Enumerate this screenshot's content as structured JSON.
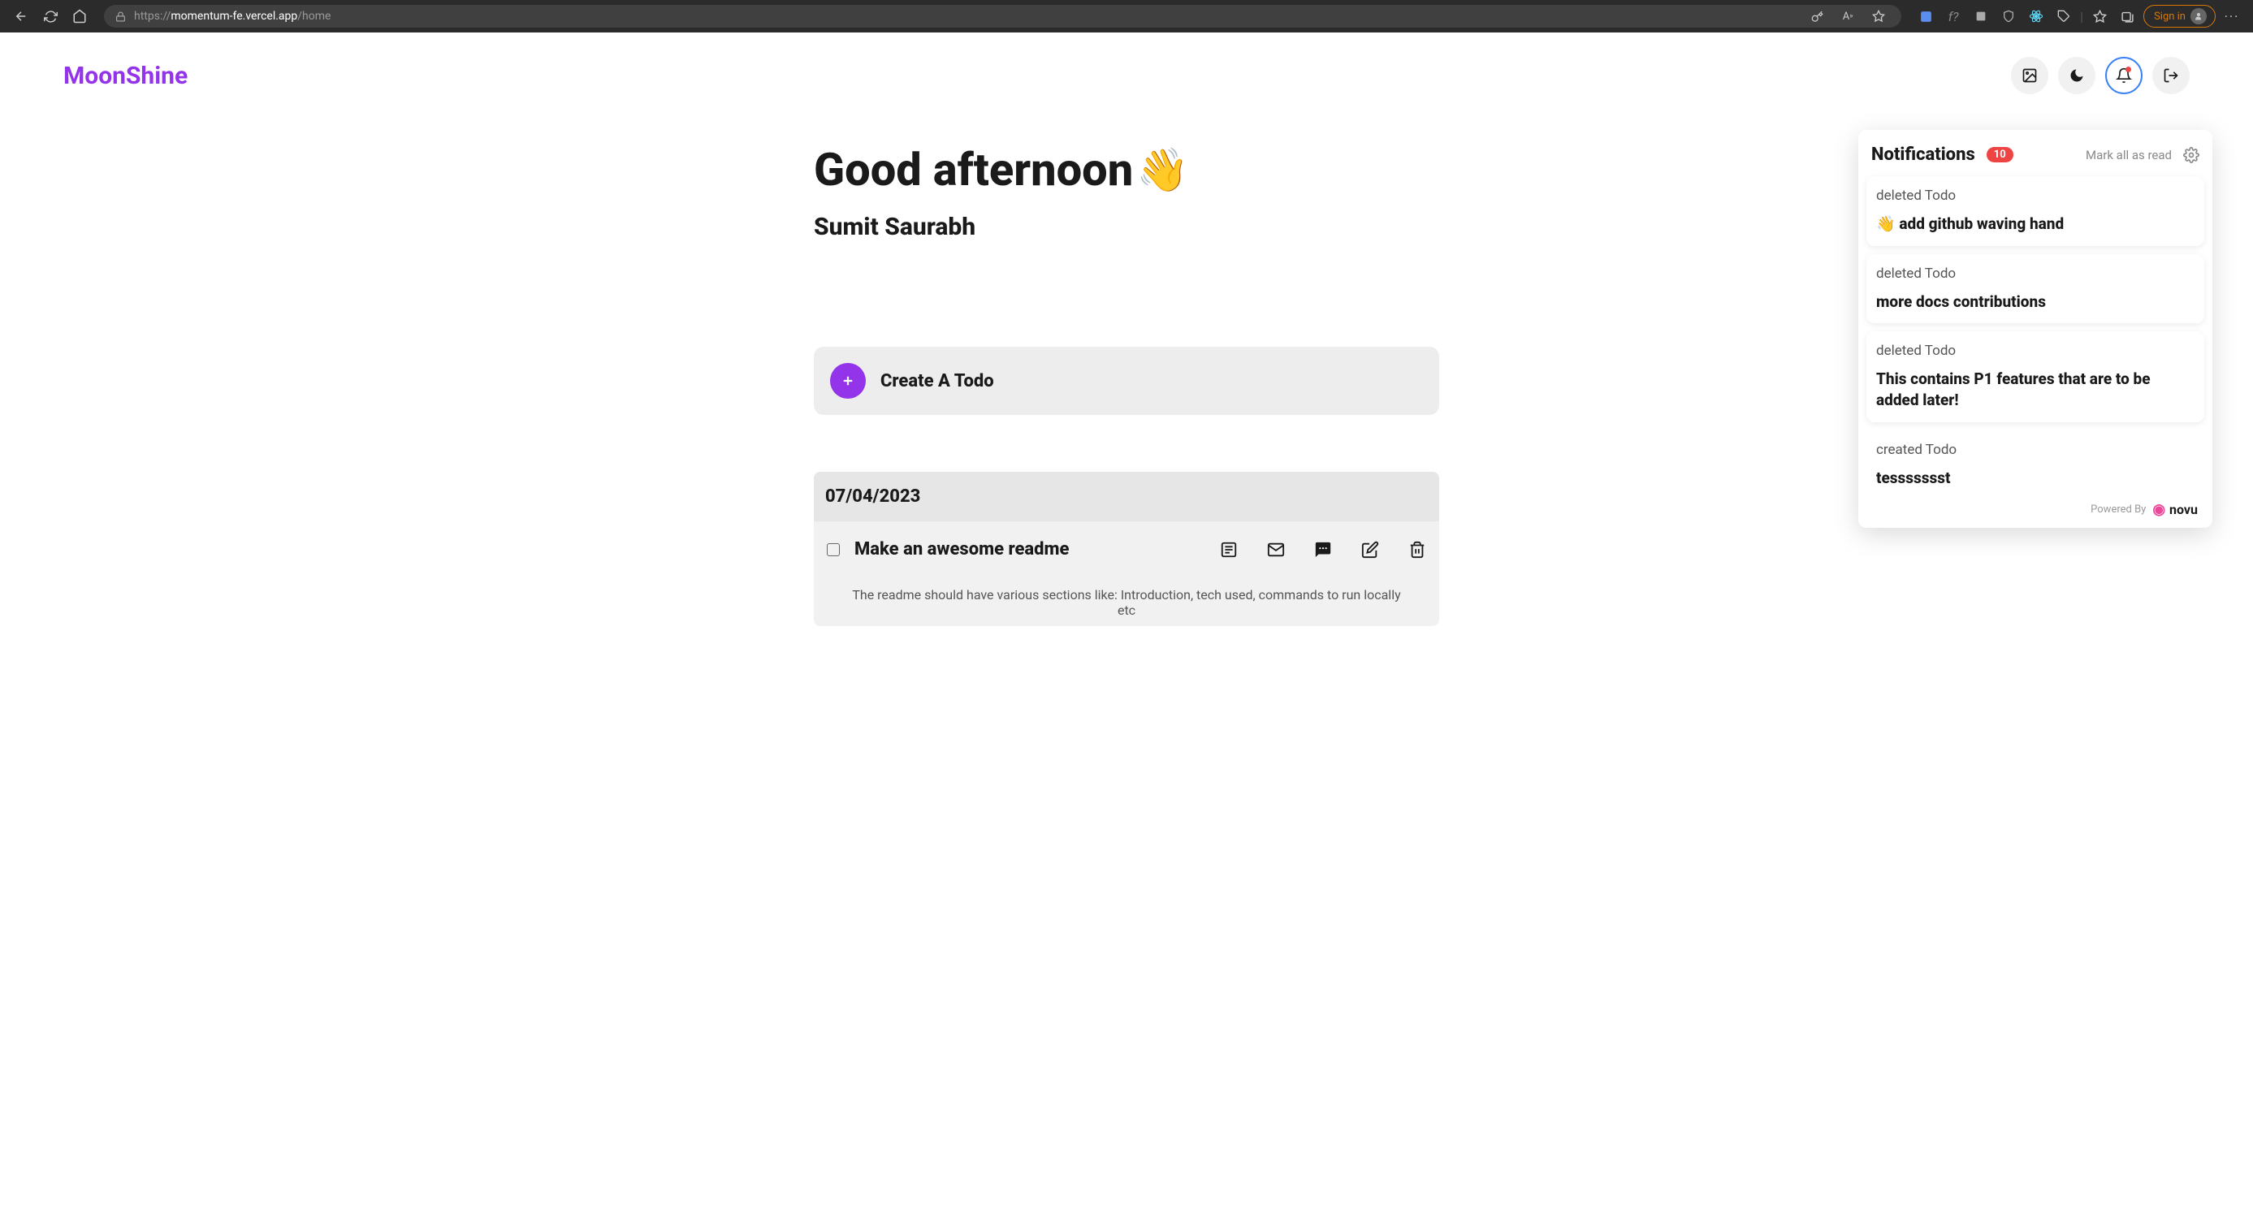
{
  "browser": {
    "url_prefix": "https://",
    "url_domain": "momentum-fe.vercel.app",
    "url_path": "/home",
    "signin_label": "Sign in"
  },
  "header": {
    "logo": "MoonShine"
  },
  "greeting": {
    "text": "Good afternoon",
    "emoji": "👋",
    "username": "Sumit Saurabh"
  },
  "create_todo": {
    "label": "Create A Todo"
  },
  "todo_group": {
    "date": "07/04/2023",
    "items": [
      {
        "title": "Make an awesome readme",
        "description": "The readme should have various sections like: Introduction, tech used, commands to run locally etc"
      }
    ]
  },
  "notifications": {
    "title": "Notifications",
    "count": "10",
    "mark_all_label": "Mark all as read",
    "powered_by_label": "Powered By",
    "powered_by_brand": "novu",
    "items": [
      {
        "action": "deleted Todo",
        "body": "👋 add github waving hand"
      },
      {
        "action": "deleted Todo",
        "body": "more docs contributions"
      },
      {
        "action": "deleted Todo",
        "body": "This contains P1 features that are to be added later!"
      },
      {
        "action": "created Todo",
        "body": "tessssssst"
      }
    ]
  }
}
